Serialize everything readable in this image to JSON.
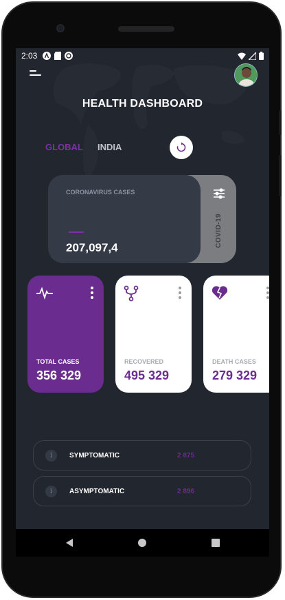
{
  "status_bar": {
    "time": "2:03",
    "left_icons": [
      "a-icon",
      "sd-card-icon",
      "sync-icon"
    ],
    "right_icons": [
      "wifi-icon",
      "signal-icon",
      "battery-icon"
    ]
  },
  "header": {
    "title": "HEALTH DASHBOARD"
  },
  "tabs": [
    {
      "label": "GLOBAL",
      "active": true
    },
    {
      "label": "INDIA",
      "active": false
    }
  ],
  "cases_card": {
    "label": "CORONAVIRUS CASES",
    "value": "207,097,4",
    "side_tab_label": "COVID-19"
  },
  "stat_cards": [
    {
      "label": "TOTAL CASES",
      "value": "356 329",
      "icon": "heartbeat-icon"
    },
    {
      "label": "RECOVERED",
      "value": "495 329",
      "icon": "fork-icon"
    },
    {
      "label": "DEATH CASES",
      "value": "279 329",
      "icon": "broken-heart-icon"
    }
  ],
  "rows": [
    {
      "label": "SYMPTOMATIC",
      "value": "2 875"
    },
    {
      "label": "ASYMPTOMATIC",
      "value": "2 896"
    }
  ],
  "info_glyph": "i",
  "colors": {
    "accent": "#6a2c8e",
    "background": "#22262e",
    "card_dark": "#353a47",
    "tab_gray": "#7b7d80"
  },
  "nav_bar": [
    "back-icon",
    "home-icon",
    "recents-icon"
  ]
}
